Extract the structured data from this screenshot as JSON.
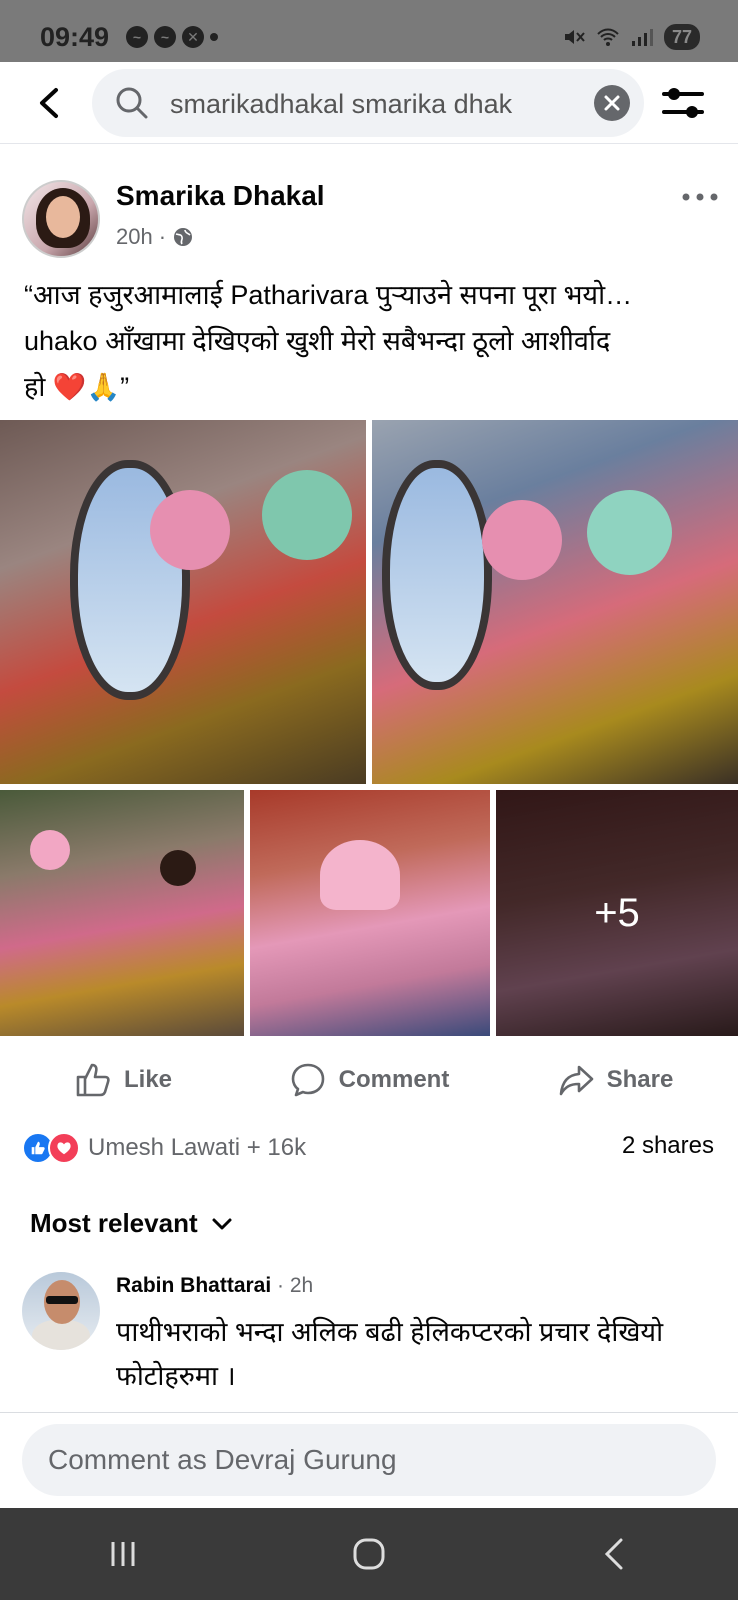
{
  "status_bar": {
    "time": "09:49",
    "battery": "77",
    "icons": [
      "messenger-icon",
      "messenger-icon",
      "app-notification-icon",
      "dot-icon",
      "mute-icon",
      "wifi-icon",
      "signal-icon"
    ]
  },
  "search": {
    "query": "smarikadhakal smarika dhak"
  },
  "post": {
    "author": "Smarika Dhakal",
    "time": "20h",
    "separator": "·",
    "caption_line1": "“आज हजुरआमालाई Patharivara पुऱ्याउने सपना पूरा भयो…",
    "caption_line2": "uhako आँखामा देखिएको खुशी मेरो सबैभन्दा ठूलो आशीर्वाद",
    "caption_line3": "हो ❤️🙏”",
    "more_photos": "+5"
  },
  "actions": {
    "like": "Like",
    "comment": "Comment",
    "share": "Share"
  },
  "reactions": {
    "summary": "Umesh Lawati + 16k",
    "shares": "2 shares"
  },
  "comments": {
    "sort_label": "Most relevant",
    "items": [
      {
        "name": "Rabin Bhattarai",
        "time": " · 2h",
        "text": "पाथीभराको भन्दा अलिक बढी हेलिकप्टरको प्रचार देखियो फोटोहरुमा ।"
      }
    ],
    "input_placeholder": "Comment as Devraj Gurung"
  },
  "colors": {
    "brand_blue": "#1877f2",
    "love_red": "#f33e58",
    "secondary_text": "#65676b"
  }
}
